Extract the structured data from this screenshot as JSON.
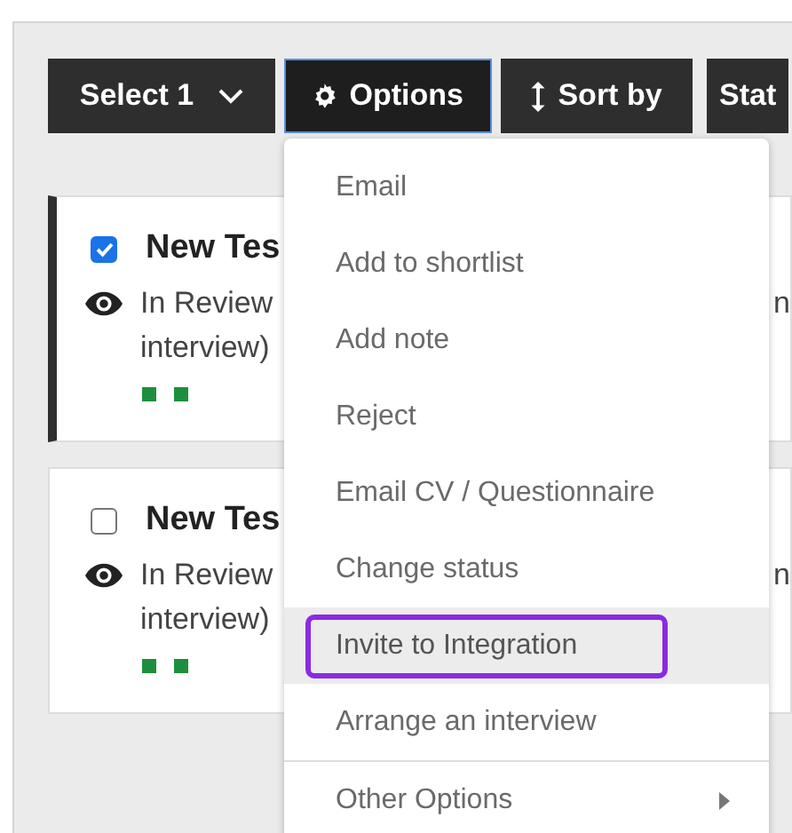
{
  "toolbar": [
    {
      "kind": "dropdown",
      "label": "Select 1",
      "selected": false
    },
    {
      "kind": "gear",
      "label": "Options",
      "selected": true
    },
    {
      "kind": "sort",
      "label": "Sort by",
      "selected": false
    },
    {
      "kind": "plain",
      "label": "Stat",
      "selected": false
    }
  ],
  "cards": [
    {
      "checked": true,
      "selected": true,
      "title": "New Tes",
      "status": "In Review",
      "status_tail": "n",
      "line_2": "interview)",
      "dots": [
        {
          "color": "#1e8e3e"
        },
        {
          "color": "#1e8e3e"
        }
      ]
    },
    {
      "checked": false,
      "selected": false,
      "title": "New Tes",
      "status": "In Review",
      "status_tail": "n",
      "line_2": "interview)",
      "dots": [
        {
          "color": "#1e8e3e"
        },
        {
          "color": "#1e8e3e"
        }
      ]
    }
  ],
  "menu": [
    {
      "label": "Email",
      "selected": false,
      "submenu": false
    },
    {
      "label": "Add to shortlist",
      "selected": false,
      "submenu": false
    },
    {
      "label": "Add note",
      "selected": false,
      "submenu": false
    },
    {
      "label": "Reject",
      "selected": false,
      "submenu": false
    },
    {
      "label": "Email CV / Questionnaire",
      "selected": false,
      "submenu": false
    },
    {
      "label": "Change status",
      "selected": false,
      "submenu": false
    },
    {
      "label": "Invite to Integration",
      "selected": true,
      "submenu": false
    },
    {
      "label": "Arrange an interview",
      "selected": false,
      "submenu": false
    },
    {
      "label": "Other Options",
      "selected": false,
      "submenu": true
    }
  ]
}
